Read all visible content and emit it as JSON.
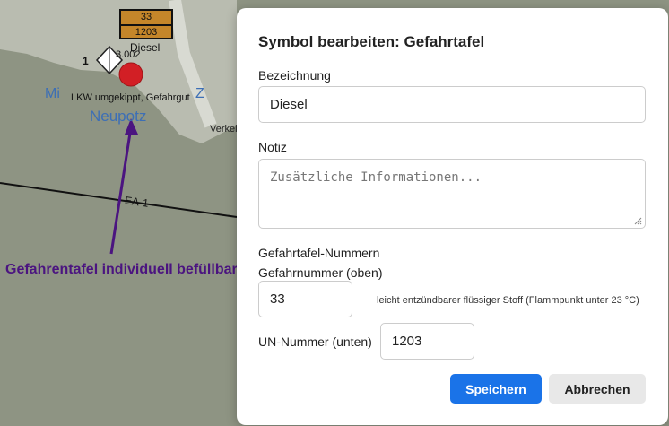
{
  "map": {
    "hazard_plate": {
      "top": "33",
      "bottom": "1203"
    },
    "hazard_name": "Diesel",
    "vehicle_count": "1",
    "vehicle_code": "3.002",
    "incident_label": "LKW umgekippt, Gefahrgut",
    "place_name": "Neupotz",
    "place_name_partial": "Mi",
    "place_name_partial2": "Z",
    "street_label": "Verkel",
    "section_label": "EA-1",
    "annotation": "Gefahrentafel individuell befüllbar",
    "colors": {
      "annotation": "#4b1480",
      "place": "#3d6fb5",
      "marker": "#d21f25"
    }
  },
  "dialog": {
    "title": "Symbol bearbeiten: Gefahrtafel",
    "name_label": "Bezeichnung",
    "name_value": "Diesel",
    "note_label": "Notiz",
    "note_placeholder": "Zusätzliche Informationen...",
    "numbers_heading": "Gefahrtafel-Nummern",
    "hazard_number_label": "Gefahrnummer (oben)",
    "hazard_number_value": "33",
    "hazard_number_hint": "leicht entzündbarer flüssiger Stoff (Flammpunkt unter 23 °C)",
    "un_number_label": "UN-Nummer (unten)",
    "un_number_value": "1203",
    "save_label": "Speichern",
    "cancel_label": "Abbrechen",
    "colors": {
      "primary": "#1a73e8"
    }
  }
}
